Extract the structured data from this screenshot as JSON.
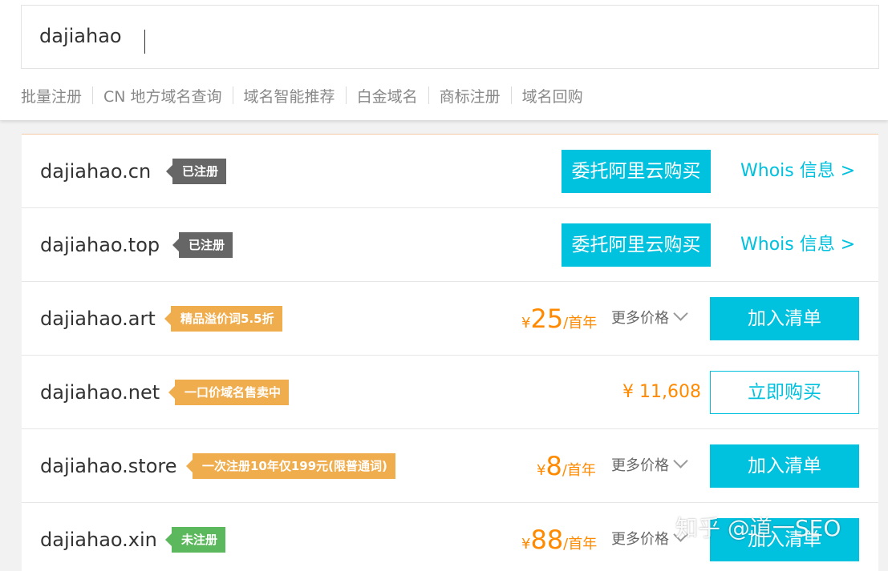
{
  "search": {
    "value": "dajiahao"
  },
  "quick_links": [
    "批量注册",
    "CN 地方域名查询",
    "域名智能推荐",
    "白金域名",
    "商标注册",
    "域名回购"
  ],
  "results": [
    {
      "domain": "dajiahao.cn",
      "tag": "已注册",
      "action": "委托阿里云购买",
      "whois": "Whois 信息 >"
    },
    {
      "domain": "dajiahao.top",
      "tag": "已注册",
      "action": "委托阿里云购买",
      "whois": "Whois 信息 >"
    },
    {
      "domain": "dajiahao.art",
      "tag": "精品溢价词5.5折",
      "currency": "¥",
      "price": "25",
      "unit": "/首年",
      "more": "更多价格",
      "action": "加入清单"
    },
    {
      "domain": "dajiahao.net",
      "tag": "一口价域名售卖中",
      "price_text": "¥ 11,608",
      "action": "立即购买"
    },
    {
      "domain": "dajiahao.store",
      "tag": "一次注册10年仅199元(限普通词)",
      "currency": "¥",
      "price": "8",
      "unit": "/首年",
      "more": "更多价格",
      "action": "加入清单"
    },
    {
      "domain": "dajiahao.xin",
      "tag": "未注册",
      "currency": "¥",
      "price": "88",
      "unit": "/首年",
      "more": "更多价格",
      "action": "加入清单"
    }
  ],
  "watermark": "知乎 @道一SEO",
  "colors": {
    "accent": "#00c1de",
    "price": "#ff8a00",
    "tag_registered": "#666666",
    "tag_promo": "#f0ad4e",
    "tag_available": "#5cb85c"
  }
}
